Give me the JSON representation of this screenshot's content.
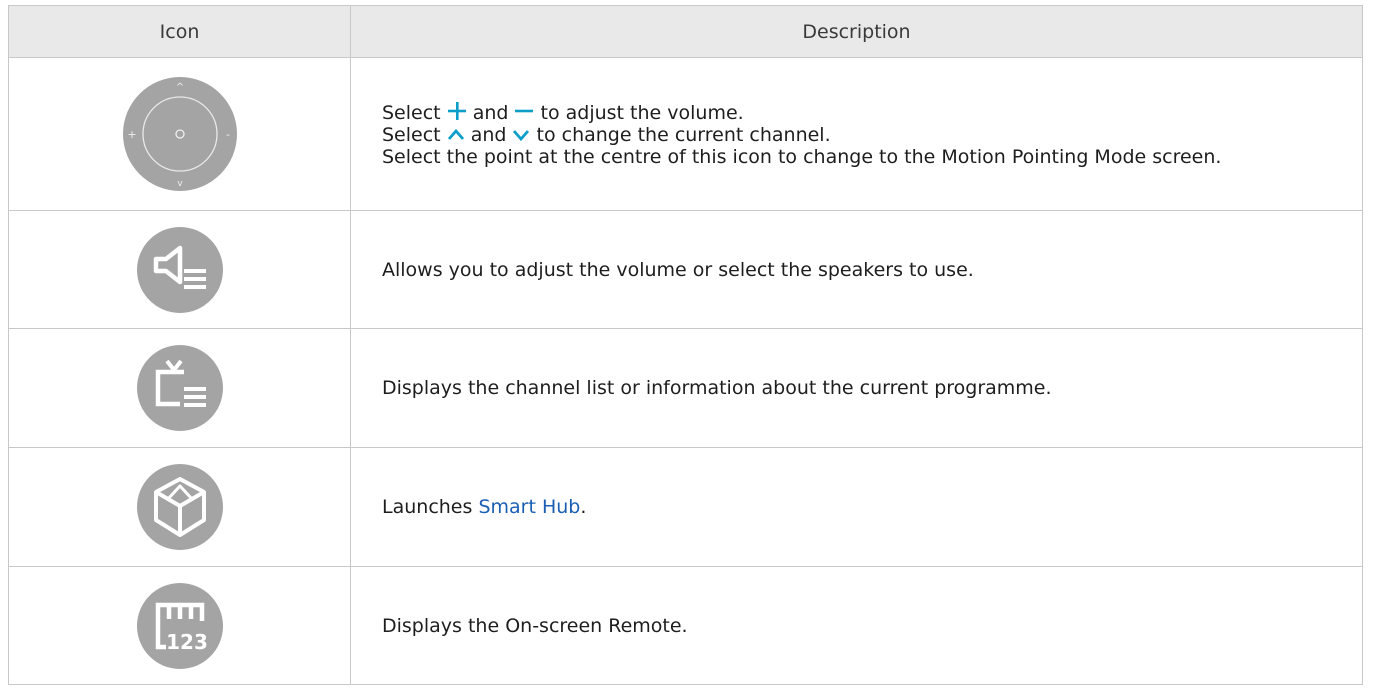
{
  "table": {
    "headers": {
      "icon": "Icon",
      "description": "Description"
    },
    "rows": [
      {
        "icon": "volume-channel-pad-icon",
        "icon_labels": {
          "up": "^",
          "down": "v",
          "plus": "+",
          "minus": "-"
        },
        "line1_a": "Select ",
        "line1_b": " and ",
        "line1_c": " to adjust the volume.",
        "line2_a": "Select ",
        "line2_b": " and ",
        "line2_c": " to change the current channel.",
        "line3": "Select the point at the centre of this icon to change to the Motion Pointing Mode screen."
      },
      {
        "icon": "speaker-list-icon",
        "text": "Allows you to adjust the volume or select the speakers to use."
      },
      {
        "icon": "tv-channel-list-icon",
        "text": "Displays the channel list or information about the current programme."
      },
      {
        "icon": "smart-hub-cube-icon",
        "text_a": "Launches ",
        "text_link": "Smart Hub",
        "text_b": "."
      },
      {
        "icon": "onscreen-remote-123-icon",
        "icon_text": "123",
        "text": "Displays the On-screen Remote."
      }
    ]
  },
  "colors": {
    "header_bg": "#e9e9e9",
    "border": "#c8c8c8",
    "icon_grey": "#a4a4a4",
    "accent": "#0a9ec9",
    "link": "#1a5fb4"
  }
}
